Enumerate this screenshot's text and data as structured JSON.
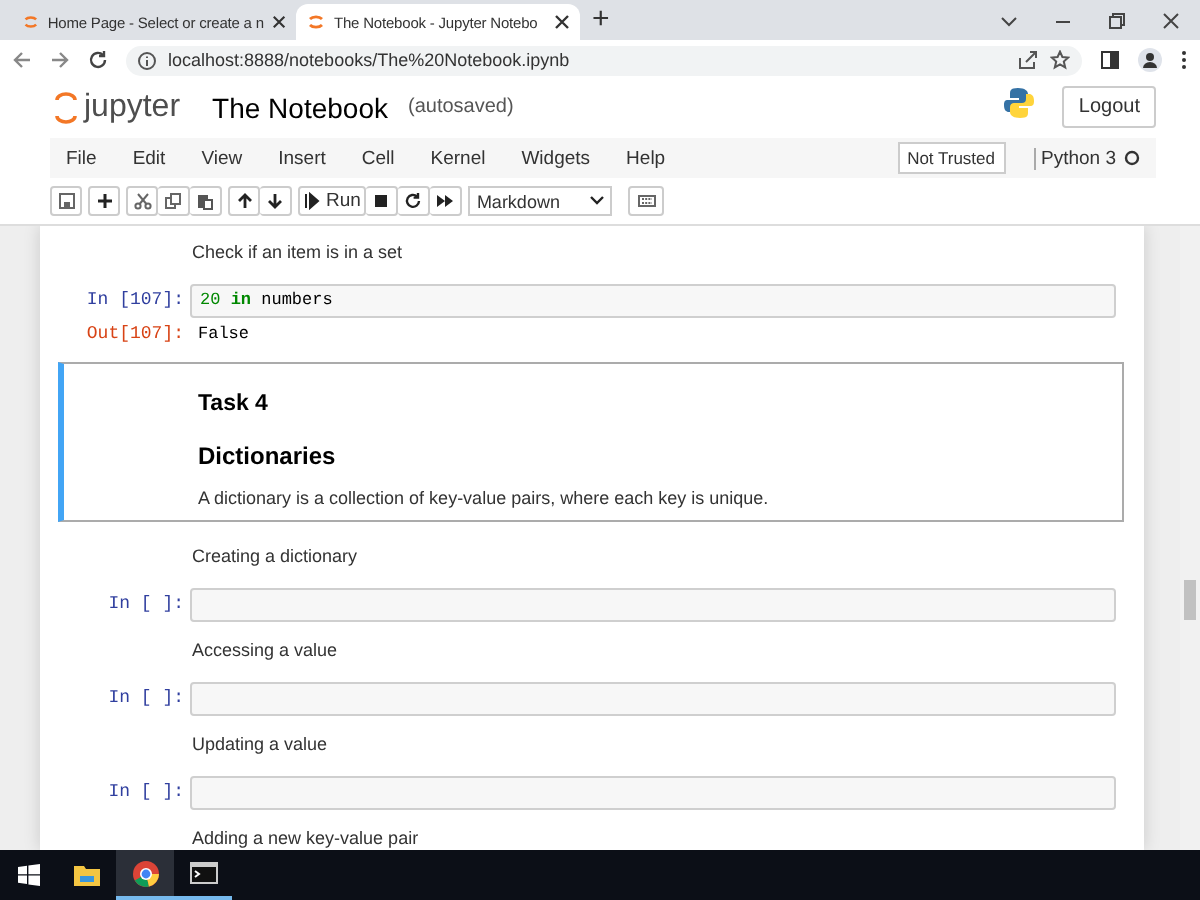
{
  "browser": {
    "tabs": [
      {
        "title": "Home Page - Select or create a n",
        "selected": false
      },
      {
        "title": "The Notebook - Jupyter Notebo",
        "selected": true
      }
    ],
    "new_tab": "+",
    "url": "localhost:8888/notebooks/The%20Notebook.ipynb"
  },
  "header": {
    "logo": "jupyter",
    "notebook_name": "The Notebook",
    "save_status": "(autosaved)",
    "logout": "Logout"
  },
  "menu": [
    "File",
    "Edit",
    "View",
    "Insert",
    "Cell",
    "Kernel",
    "Widgets",
    "Help"
  ],
  "trust": "Not Trusted",
  "kernel": "Python 3",
  "toolbar": {
    "run": "Run",
    "cell_type": "Markdown"
  },
  "cells": [
    {
      "kind": "text",
      "selected": false,
      "text": "Check if an item is in a set"
    },
    {
      "kind": "code",
      "selected": false,
      "prompt": "In [107]:",
      "code": [
        {
          "kind": "number",
          "text": "20"
        },
        {
          "kind": "keyword",
          "text": "in"
        },
        {
          "kind": "name",
          "text": "numbers"
        }
      ],
      "output_prompt": "Out[107]:",
      "output": "False"
    },
    {
      "kind": "markdown",
      "selected": true,
      "heading": "Task 4",
      "subheading": "Dictionaries",
      "text": "A dictionary is a collection of key-value pairs, where each key is unique."
    },
    {
      "kind": "text",
      "selected": false,
      "text": "Creating a dictionary"
    },
    {
      "kind": "code",
      "selected": false,
      "prompt": "In [ ]:"
    },
    {
      "kind": "text",
      "selected": false,
      "text": "Accessing a value"
    },
    {
      "kind": "code",
      "selected": false,
      "prompt": "In [ ]:"
    },
    {
      "kind": "text",
      "selected": false,
      "text": "Updating a value"
    },
    {
      "kind": "code",
      "selected": false,
      "prompt": "In [ ]:"
    },
    {
      "kind": "text",
      "selected": false,
      "text": "Adding a new key-value pair"
    }
  ]
}
